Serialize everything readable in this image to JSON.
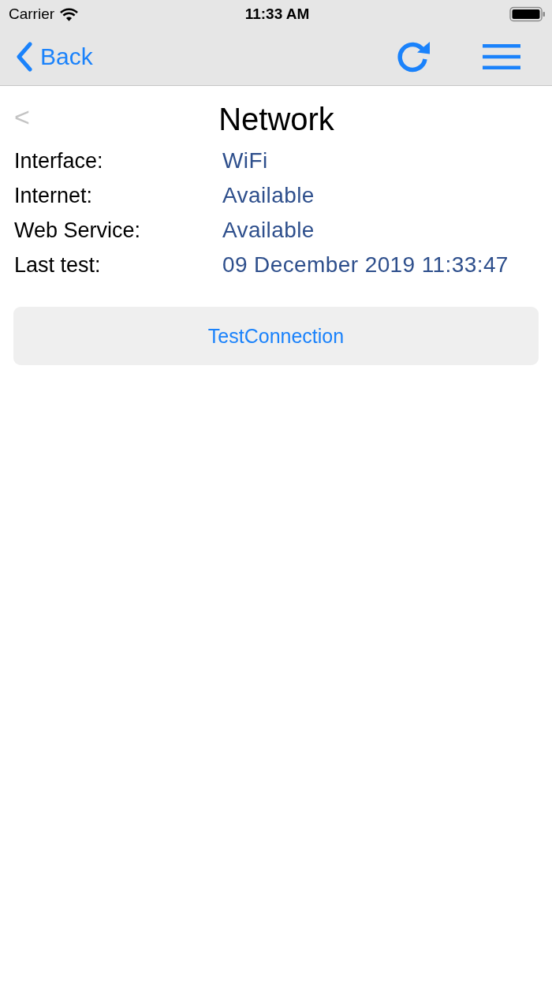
{
  "status_bar": {
    "carrier": "Carrier",
    "time": "11:33 AM"
  },
  "nav_bar": {
    "back_label": "Back"
  },
  "page": {
    "back_arrow": {
      "label": "<",
      "disabled": true
    },
    "title": "Network"
  },
  "details": [
    {
      "label": "Interface:",
      "value": "WiFi"
    },
    {
      "label": "Internet:",
      "value": "Available"
    },
    {
      "label": "Web Service:",
      "value": "Available"
    },
    {
      "label": "Last test:",
      "value": "09 December 2019 11:33:47"
    }
  ],
  "button": {
    "label": "TestConnection"
  }
}
